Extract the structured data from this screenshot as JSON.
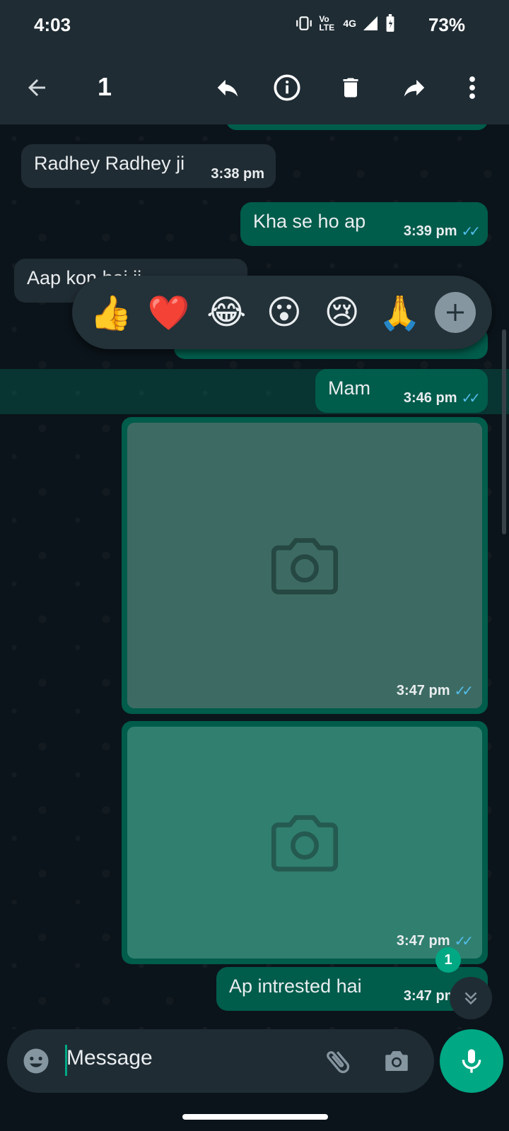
{
  "status": {
    "time": "4:03",
    "network_label": "4G",
    "volte_label": "Vo LTE",
    "battery": "73%"
  },
  "toolbar": {
    "selected_count": "1",
    "icons": [
      "back-arrow-icon",
      "reply-icon",
      "info-icon",
      "delete-icon",
      "forward-icon",
      "more-vert-icon"
    ]
  },
  "messages": [
    {
      "direction": "in",
      "text": "Radhey Radhey ji",
      "time": "3:38 pm"
    },
    {
      "direction": "out",
      "text": "Kha se ho ap",
      "time": "3:39 pm",
      "ticks": "✓✓"
    },
    {
      "direction": "in",
      "text": "Aap kon hai ji"
    },
    {
      "direction": "out",
      "text": "Mam",
      "time": "3:46 pm",
      "ticks": "✓✓"
    },
    {
      "direction": "out",
      "type": "image",
      "time": "3:47 pm",
      "ticks": "✓✓"
    },
    {
      "direction": "out",
      "type": "image",
      "time": "3:47 pm",
      "ticks": "✓✓"
    },
    {
      "direction": "out",
      "text": "Ap intrested hai",
      "time": "3:47 pm",
      "ticks": "✓✓"
    }
  ],
  "reactions": [
    "👍",
    "❤️",
    "😂",
    "😮",
    "😢",
    "🙏"
  ],
  "unread_count": "1",
  "composer": {
    "placeholder": "Message"
  },
  "colors": {
    "bubble_out": "#005c4b",
    "bubble_in": "#202c33",
    "accent": "#00a884",
    "ticks": "#53bdeb"
  }
}
